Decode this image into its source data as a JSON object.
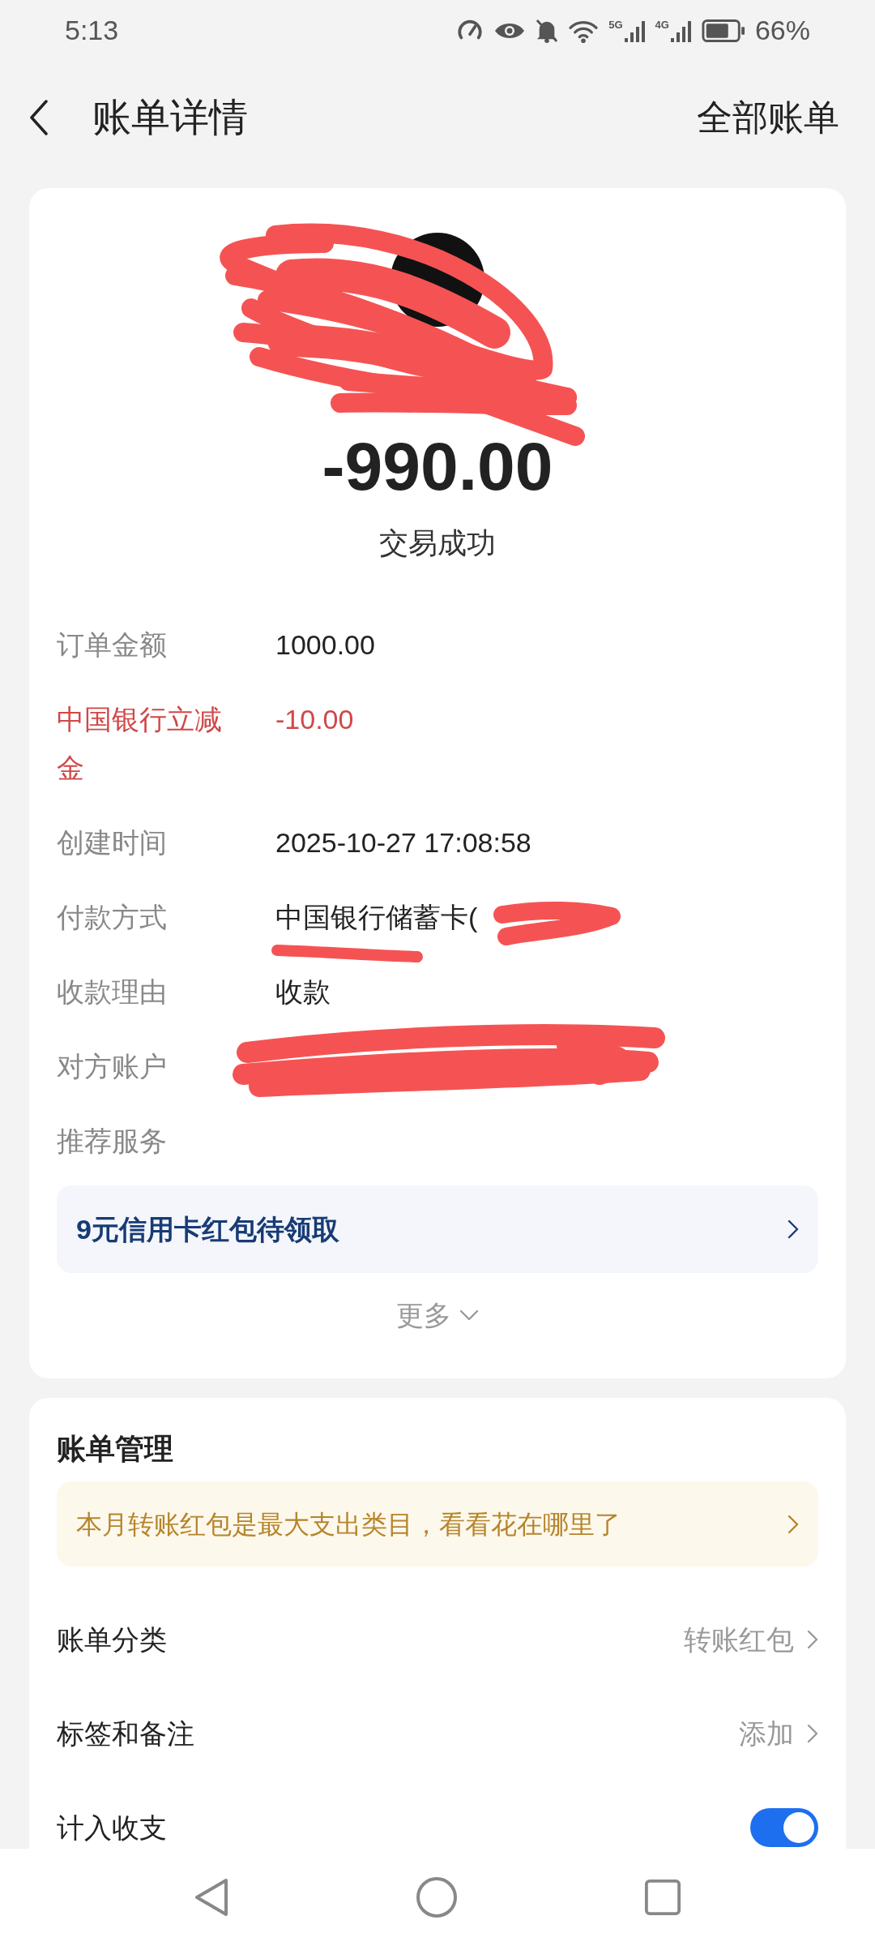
{
  "status_bar": {
    "time": "5:13",
    "network_labels": [
      "5G",
      "4G"
    ],
    "battery": "66%"
  },
  "header": {
    "title": "账单详情",
    "action": "全部账单"
  },
  "summary": {
    "amount": "-990.00",
    "status": "交易成功"
  },
  "details": [
    {
      "label": "订单金额",
      "value": "1000.00",
      "highlight": false
    },
    {
      "label": "中国银行立减金",
      "value": "-10.00",
      "highlight": true
    },
    {
      "label": "创建时间",
      "value": "2025-10-27 17:08:58",
      "highlight": false
    },
    {
      "label": "付款方式",
      "value": "中国银行储蓄卡(",
      "highlight": false
    },
    {
      "label": "收款理由",
      "value": "收款",
      "highlight": false
    },
    {
      "label": "对方账户",
      "highlight": false
    },
    {
      "label": "推荐服务",
      "highlight": false
    }
  ],
  "promo": {
    "text": "9元信用卡红包待领取"
  },
  "more": "更多",
  "management": {
    "title": "账单管理",
    "tip": "本月转账红包是最大支出类目，看看花在哪里了",
    "rows": [
      {
        "kind": "link",
        "label": "账单分类",
        "value": "转账红包"
      },
      {
        "kind": "link",
        "label": "标签和备注",
        "value": "添加"
      },
      {
        "kind": "toggle",
        "label": "计入收支",
        "on": true
      }
    ]
  }
}
